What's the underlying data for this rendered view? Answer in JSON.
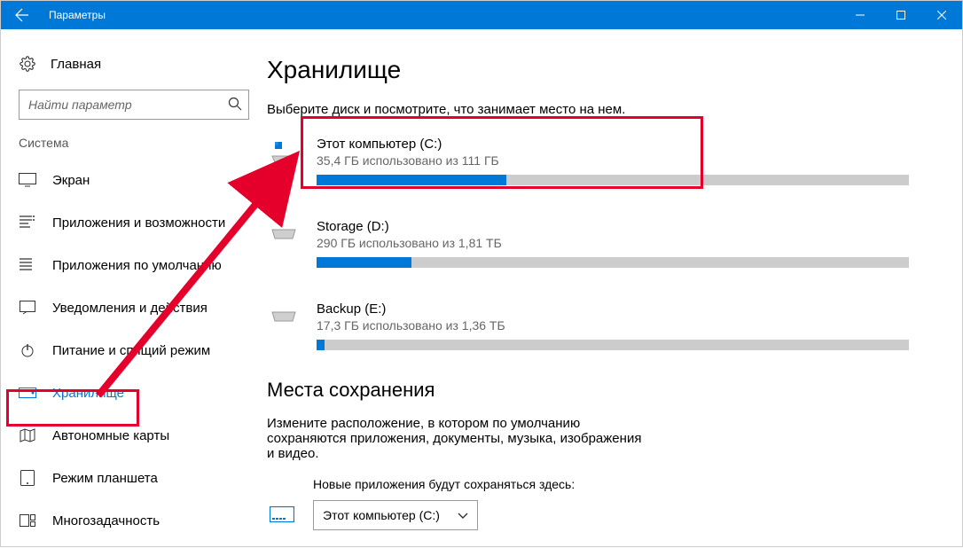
{
  "titlebar": {
    "title": "Параметры"
  },
  "sidebar": {
    "home": "Главная",
    "search_placeholder": "Найти параметр",
    "group": "Система",
    "items": [
      {
        "label": "Экран"
      },
      {
        "label": "Приложения и возможности"
      },
      {
        "label": "Приложения по умолчанию"
      },
      {
        "label": "Уведомления и действия"
      },
      {
        "label": "Питание и спящий режим"
      },
      {
        "label": "Хранилище"
      },
      {
        "label": "Автономные карты"
      },
      {
        "label": "Режим планшета"
      },
      {
        "label": "Многозадачность"
      }
    ]
  },
  "main": {
    "heading": "Хранилище",
    "subheading": "Выберите диск и посмотрите, что занимает место на нем.",
    "drives": [
      {
        "name": "Этот компьютер (C:)",
        "usage": "35,4 ГБ использовано из 111 ГБ",
        "pct": 32
      },
      {
        "name": "Storage (D:)",
        "usage": "290 ГБ использовано из 1,81 ТБ",
        "pct": 16
      },
      {
        "name": "Backup (E:)",
        "usage": "17,3 ГБ использовано из 1,36 ТБ",
        "pct": 1.3
      }
    ],
    "save_heading": "Места сохранения",
    "save_desc": "Измените расположение, в котором по умолчанию сохраняются приложения, документы, музыка, изображения и видео.",
    "save_apps_label": "Новые приложения будут сохраняться здесь:",
    "save_apps_value": "Этот компьютер (C:)"
  }
}
